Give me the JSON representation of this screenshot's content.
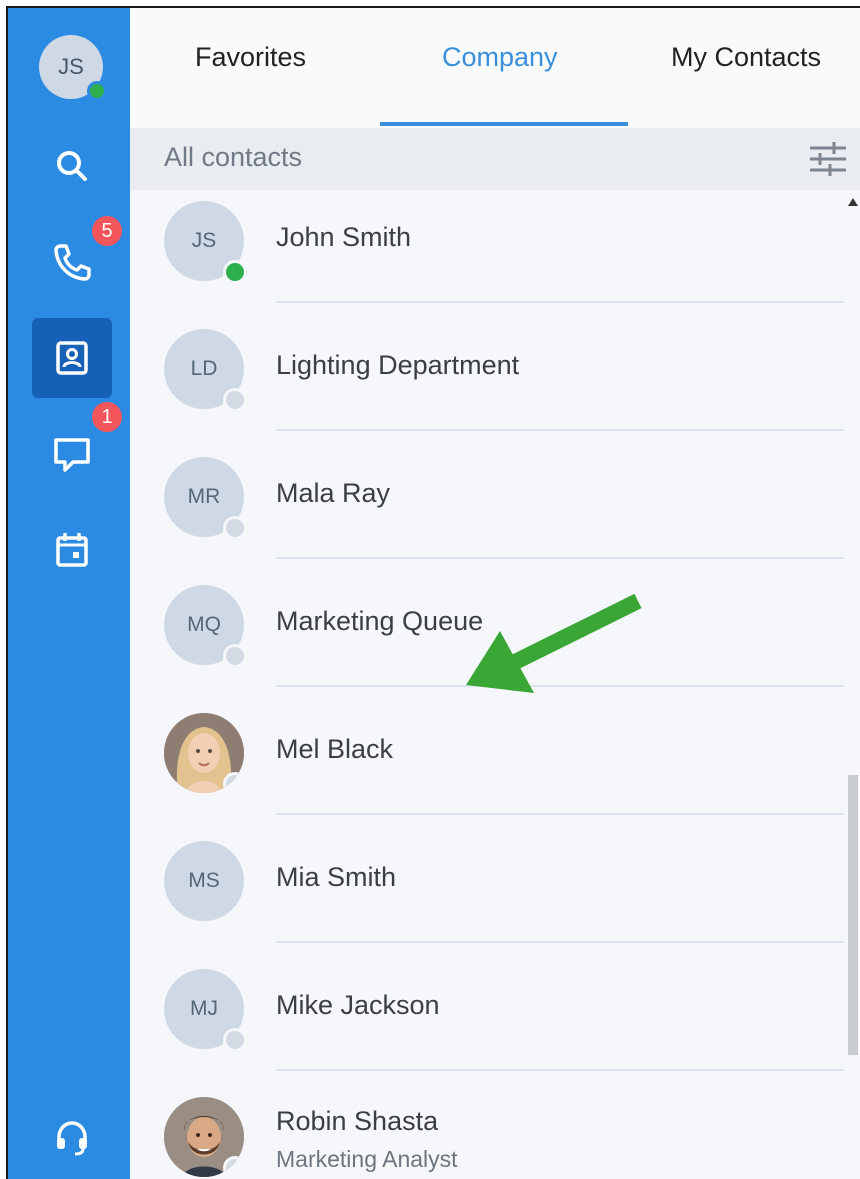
{
  "user": {
    "initials": "JS"
  },
  "rail": {
    "calls_badge": "5",
    "messages_badge": "1"
  },
  "tabs": [
    {
      "label": "Favorites"
    },
    {
      "label": "Company"
    },
    {
      "label": "My Contacts"
    }
  ],
  "filter": {
    "label": "All contacts"
  },
  "contacts": [
    {
      "initials": "JS",
      "name": "John Smith",
      "status": "online"
    },
    {
      "initials": "LD",
      "name": "Lighting Department",
      "status": "offline"
    },
    {
      "initials": "MR",
      "name": "Mala Ray",
      "status": "offline"
    },
    {
      "initials": "MQ",
      "name": "Marketing Queue",
      "status": "offline"
    },
    {
      "initials": "",
      "name": "Mel Black",
      "status": "offline"
    },
    {
      "initials": "MS",
      "name": "Mia Smith",
      "status": "none"
    },
    {
      "initials": "MJ",
      "name": "Mike Jackson",
      "status": "offline"
    },
    {
      "initials": "",
      "name": "Robin Shasta",
      "subtitle": "Marketing Analyst",
      "status": "offline"
    }
  ],
  "colors": {
    "rail": "#2b8ae2",
    "rail_active": "#1760b8",
    "accent": "#3a8fdb",
    "online": "#2db04b",
    "badge": "#f2565a",
    "annotation_arrow": "#3aa635"
  }
}
